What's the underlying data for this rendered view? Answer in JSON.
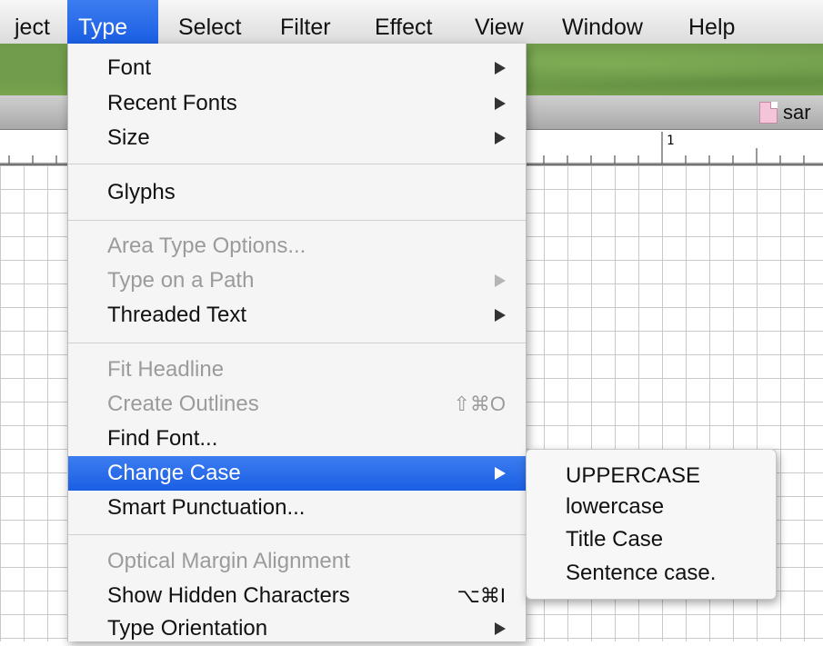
{
  "menubar": {
    "items": [
      "ject",
      "Type",
      "Select",
      "Filter",
      "Effect",
      "View",
      "Window",
      "Help"
    ],
    "active": "Type"
  },
  "document_tab": {
    "label": "sar"
  },
  "ruler": {
    "label": "1"
  },
  "type_menu": {
    "font": "Font",
    "recent_fonts": "Recent Fonts",
    "size": "Size",
    "glyphs": "Glyphs",
    "area_type_options": "Area Type Options...",
    "type_on_a_path": "Type on a Path",
    "threaded_text": "Threaded Text",
    "fit_headline": "Fit Headline",
    "create_outlines": "Create Outlines",
    "create_outlines_shortcut": "⇧⌘O",
    "find_font": "Find Font...",
    "change_case": "Change Case",
    "smart_punctuation": "Smart Punctuation...",
    "optical_margin_alignment": "Optical Margin Alignment",
    "show_hidden_characters": "Show Hidden Characters",
    "show_hidden_characters_shortcut": "⌥⌘I",
    "type_orientation": "Type Orientation"
  },
  "change_case_submenu": {
    "uppercase": "UPPERCASE",
    "lowercase": "lowercase",
    "title_case": "Title Case",
    "sentence_case": "Sentence case."
  }
}
